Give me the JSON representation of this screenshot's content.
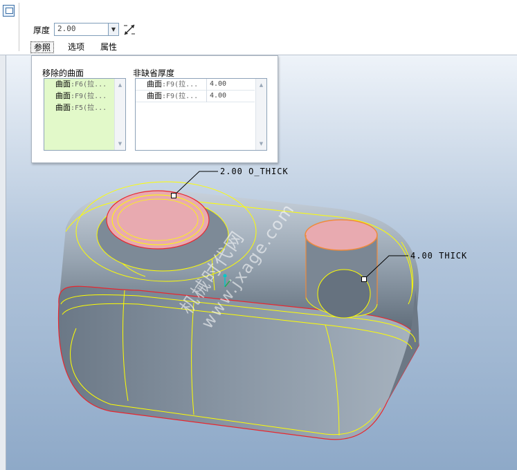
{
  "dashboard": {
    "thickness_label": "厚度",
    "thickness_value": "2.00",
    "tabs": [
      {
        "label": "参照"
      },
      {
        "label": "选项"
      },
      {
        "label": "属性"
      }
    ]
  },
  "references_panel": {
    "removed_surfaces_heading": "移除的曲面",
    "removed_surfaces": [
      {
        "name": "曲面",
        "ref": ":F6(拉..."
      },
      {
        "name": "曲面",
        "ref": ":F9(拉..."
      },
      {
        "name": "曲面",
        "ref": ":F5(拉..."
      }
    ],
    "nondefault_heading": "非缺省厚度",
    "nondefault_thickness": [
      {
        "name": "曲面",
        "ref": ":F9(拉...",
        "value": "4.00"
      },
      {
        "name": "曲面",
        "ref": ":F9(拉...",
        "value": "4.00"
      }
    ]
  },
  "model": {
    "annotation_top": "2.00 O_THICK",
    "annotation_boss": "4.00 THICK"
  },
  "watermark": {
    "text": "机械时代网",
    "url": "www.jxage.com"
  },
  "colors": {
    "removed_list_bg": "#e2f9c9",
    "edge_highlight": "#ffff00",
    "selection_fill": "#e8aab0",
    "boundary_red": "#e8262e",
    "model_body": "#8a97a4"
  }
}
